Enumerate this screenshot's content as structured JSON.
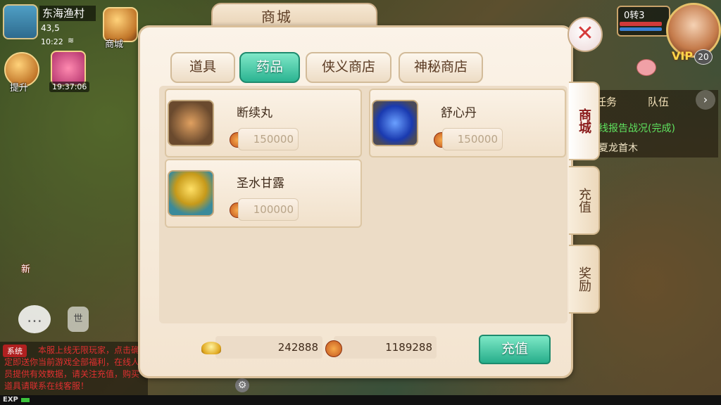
{
  "hud": {
    "location": "东海渔村",
    "coords": "43,5",
    "time": "10:22",
    "shop_shortcut": "商城",
    "upgrade_label": "提升",
    "timer": "19:37:06",
    "rebirth_level": "0转3",
    "vip_label": "VIP",
    "vip_level": "20",
    "new_label": "新",
    "mic_label": "世"
  },
  "quest": {
    "tab_task": "任务",
    "tab_team": "队伍",
    "line1": "线报告战况(完成)",
    "line2": "夏龙首木"
  },
  "system_log": {
    "tag": "系统",
    "message": "本服上线无限玩家，点击确定即送你当前游戏全部福利，在线人员提供有效数据，请关注充值，购买道具请联系在线客服！"
  },
  "exp_label": "EXP",
  "shop": {
    "title": "商城",
    "close_symbol": "✕",
    "tabs": [
      {
        "label": "道具",
        "active": false
      },
      {
        "label": "药品",
        "active": true
      },
      {
        "label": "侠义商店",
        "active": false
      },
      {
        "label": "神秘商店",
        "active": false
      }
    ],
    "items": [
      {
        "name": "断续丸",
        "price": "150000",
        "icon": "ginseng-icon"
      },
      {
        "name": "舒心丹",
        "price": "150000",
        "icon": "blue-gem-icon"
      },
      {
        "name": "圣水甘露",
        "price": "100000",
        "icon": "golden-orb-icon"
      }
    ],
    "side_tabs": [
      {
        "label": "商城",
        "active": true
      },
      {
        "label": "充值",
        "active": false
      },
      {
        "label": "奖励",
        "active": false
      }
    ],
    "gold_ingot": "242888",
    "copper_coin": "1189288",
    "recharge_label": "充值"
  }
}
